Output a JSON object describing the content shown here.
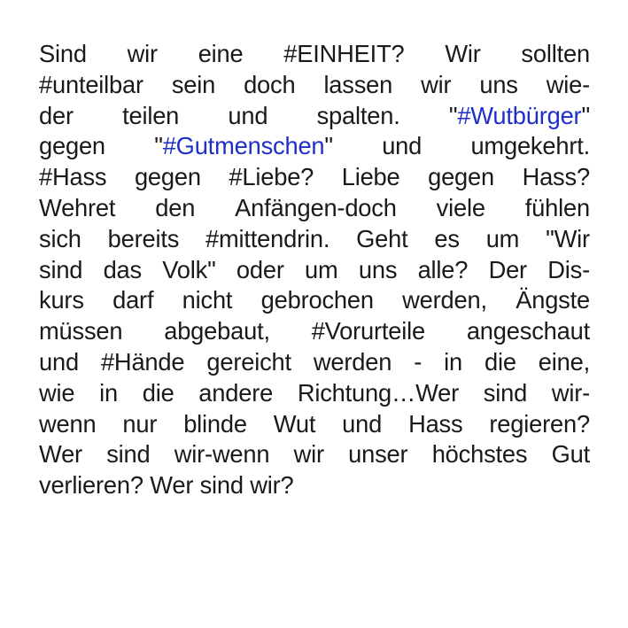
{
  "text": {
    "link_color": "#1f2fc8",
    "lines": [
      {
        "words": [
          "Sind",
          "wir",
          "eine",
          "#EINHEIT?",
          "Wir",
          "sollten"
        ]
      },
      {
        "words": [
          "#unteilbar",
          "sein",
          "doch",
          "lassen",
          "wir",
          "uns",
          "wie-"
        ]
      },
      {
        "words": [
          "der",
          "teilen",
          "und",
          "spalten.",
          "\"",
          "#Wutbürger",
          "\""
        ]
      },
      {
        "words": [
          "gegen",
          "\"",
          "#Gutmenschen",
          "\"",
          "und",
          "umgekehrt."
        ]
      },
      {
        "words": [
          "#Hass",
          "gegen",
          "#Liebe?",
          "Liebe",
          "gegen",
          "Hass?"
        ]
      },
      {
        "words": [
          "Wehret",
          "den",
          "Anfängen-doch",
          "viele",
          "fühlen"
        ]
      },
      {
        "words": [
          "sich",
          "bereits",
          "#mittendrin.",
          "Geht",
          "es",
          "um",
          "\"Wir"
        ]
      },
      {
        "words": [
          "sind",
          "das",
          "Volk\"",
          "oder",
          "um",
          "uns",
          "alle?",
          "Der",
          "Dis-"
        ]
      },
      {
        "words": [
          "kurs",
          "darf",
          "nicht",
          "gebrochen",
          "werden,",
          "Ängste"
        ]
      },
      {
        "words": [
          "müssen",
          "abgebaut,",
          "#Vorurteile",
          "angeschaut"
        ]
      },
      {
        "words": [
          "und",
          "#Hände",
          "gereicht",
          "werden",
          "-",
          "in",
          "die",
          "eine,"
        ]
      },
      {
        "words": [
          "wie",
          "in",
          "die",
          "andere",
          "Richtung…Wer",
          "sind",
          "wir-"
        ]
      },
      {
        "words": [
          "wenn",
          "nur",
          "blinde",
          "Wut",
          "und",
          "Hass",
          "regieren?"
        ]
      },
      {
        "words": [
          "Wer",
          "sind",
          "wir-wenn",
          "wir",
          "unser",
          "höchstes",
          "Gut"
        ]
      },
      {
        "words": [
          "verlieren?",
          "Wer",
          "sind",
          "wir?"
        ]
      }
    ]
  }
}
